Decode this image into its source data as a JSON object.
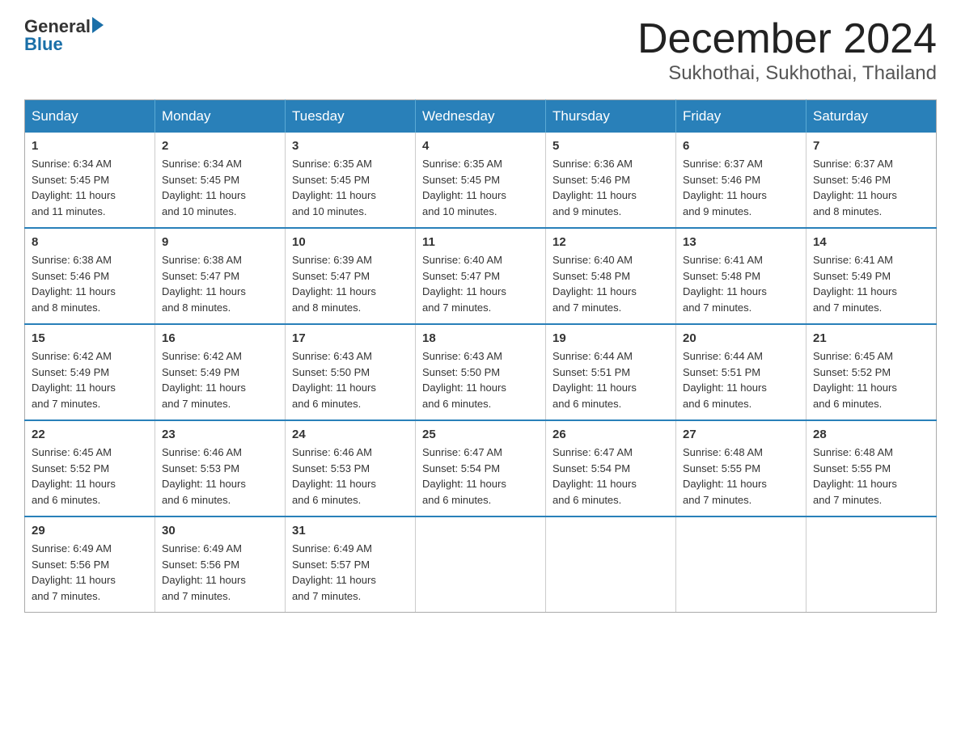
{
  "header": {
    "logo_general": "General",
    "logo_blue": "Blue",
    "month_title": "December 2024",
    "location": "Sukhothai, Sukhothai, Thailand"
  },
  "days_of_week": [
    "Sunday",
    "Monday",
    "Tuesday",
    "Wednesday",
    "Thursday",
    "Friday",
    "Saturday"
  ],
  "weeks": [
    [
      {
        "day": "1",
        "sunrise": "6:34 AM",
        "sunset": "5:45 PM",
        "daylight": "11 hours and 11 minutes."
      },
      {
        "day": "2",
        "sunrise": "6:34 AM",
        "sunset": "5:45 PM",
        "daylight": "11 hours and 10 minutes."
      },
      {
        "day": "3",
        "sunrise": "6:35 AM",
        "sunset": "5:45 PM",
        "daylight": "11 hours and 10 minutes."
      },
      {
        "day": "4",
        "sunrise": "6:35 AM",
        "sunset": "5:45 PM",
        "daylight": "11 hours and 10 minutes."
      },
      {
        "day": "5",
        "sunrise": "6:36 AM",
        "sunset": "5:46 PM",
        "daylight": "11 hours and 9 minutes."
      },
      {
        "day": "6",
        "sunrise": "6:37 AM",
        "sunset": "5:46 PM",
        "daylight": "11 hours and 9 minutes."
      },
      {
        "day": "7",
        "sunrise": "6:37 AM",
        "sunset": "5:46 PM",
        "daylight": "11 hours and 8 minutes."
      }
    ],
    [
      {
        "day": "8",
        "sunrise": "6:38 AM",
        "sunset": "5:46 PM",
        "daylight": "11 hours and 8 minutes."
      },
      {
        "day": "9",
        "sunrise": "6:38 AM",
        "sunset": "5:47 PM",
        "daylight": "11 hours and 8 minutes."
      },
      {
        "day": "10",
        "sunrise": "6:39 AM",
        "sunset": "5:47 PM",
        "daylight": "11 hours and 8 minutes."
      },
      {
        "day": "11",
        "sunrise": "6:40 AM",
        "sunset": "5:47 PM",
        "daylight": "11 hours and 7 minutes."
      },
      {
        "day": "12",
        "sunrise": "6:40 AM",
        "sunset": "5:48 PM",
        "daylight": "11 hours and 7 minutes."
      },
      {
        "day": "13",
        "sunrise": "6:41 AM",
        "sunset": "5:48 PM",
        "daylight": "11 hours and 7 minutes."
      },
      {
        "day": "14",
        "sunrise": "6:41 AM",
        "sunset": "5:49 PM",
        "daylight": "11 hours and 7 minutes."
      }
    ],
    [
      {
        "day": "15",
        "sunrise": "6:42 AM",
        "sunset": "5:49 PM",
        "daylight": "11 hours and 7 minutes."
      },
      {
        "day": "16",
        "sunrise": "6:42 AM",
        "sunset": "5:49 PM",
        "daylight": "11 hours and 7 minutes."
      },
      {
        "day": "17",
        "sunrise": "6:43 AM",
        "sunset": "5:50 PM",
        "daylight": "11 hours and 6 minutes."
      },
      {
        "day": "18",
        "sunrise": "6:43 AM",
        "sunset": "5:50 PM",
        "daylight": "11 hours and 6 minutes."
      },
      {
        "day": "19",
        "sunrise": "6:44 AM",
        "sunset": "5:51 PM",
        "daylight": "11 hours and 6 minutes."
      },
      {
        "day": "20",
        "sunrise": "6:44 AM",
        "sunset": "5:51 PM",
        "daylight": "11 hours and 6 minutes."
      },
      {
        "day": "21",
        "sunrise": "6:45 AM",
        "sunset": "5:52 PM",
        "daylight": "11 hours and 6 minutes."
      }
    ],
    [
      {
        "day": "22",
        "sunrise": "6:45 AM",
        "sunset": "5:52 PM",
        "daylight": "11 hours and 6 minutes."
      },
      {
        "day": "23",
        "sunrise": "6:46 AM",
        "sunset": "5:53 PM",
        "daylight": "11 hours and 6 minutes."
      },
      {
        "day": "24",
        "sunrise": "6:46 AM",
        "sunset": "5:53 PM",
        "daylight": "11 hours and 6 minutes."
      },
      {
        "day": "25",
        "sunrise": "6:47 AM",
        "sunset": "5:54 PM",
        "daylight": "11 hours and 6 minutes."
      },
      {
        "day": "26",
        "sunrise": "6:47 AM",
        "sunset": "5:54 PM",
        "daylight": "11 hours and 6 minutes."
      },
      {
        "day": "27",
        "sunrise": "6:48 AM",
        "sunset": "5:55 PM",
        "daylight": "11 hours and 7 minutes."
      },
      {
        "day": "28",
        "sunrise": "6:48 AM",
        "sunset": "5:55 PM",
        "daylight": "11 hours and 7 minutes."
      }
    ],
    [
      {
        "day": "29",
        "sunrise": "6:49 AM",
        "sunset": "5:56 PM",
        "daylight": "11 hours and 7 minutes."
      },
      {
        "day": "30",
        "sunrise": "6:49 AM",
        "sunset": "5:56 PM",
        "daylight": "11 hours and 7 minutes."
      },
      {
        "day": "31",
        "sunrise": "6:49 AM",
        "sunset": "5:57 PM",
        "daylight": "11 hours and 7 minutes."
      },
      null,
      null,
      null,
      null
    ]
  ],
  "labels": {
    "sunrise": "Sunrise:",
    "sunset": "Sunset:",
    "daylight": "Daylight:"
  }
}
